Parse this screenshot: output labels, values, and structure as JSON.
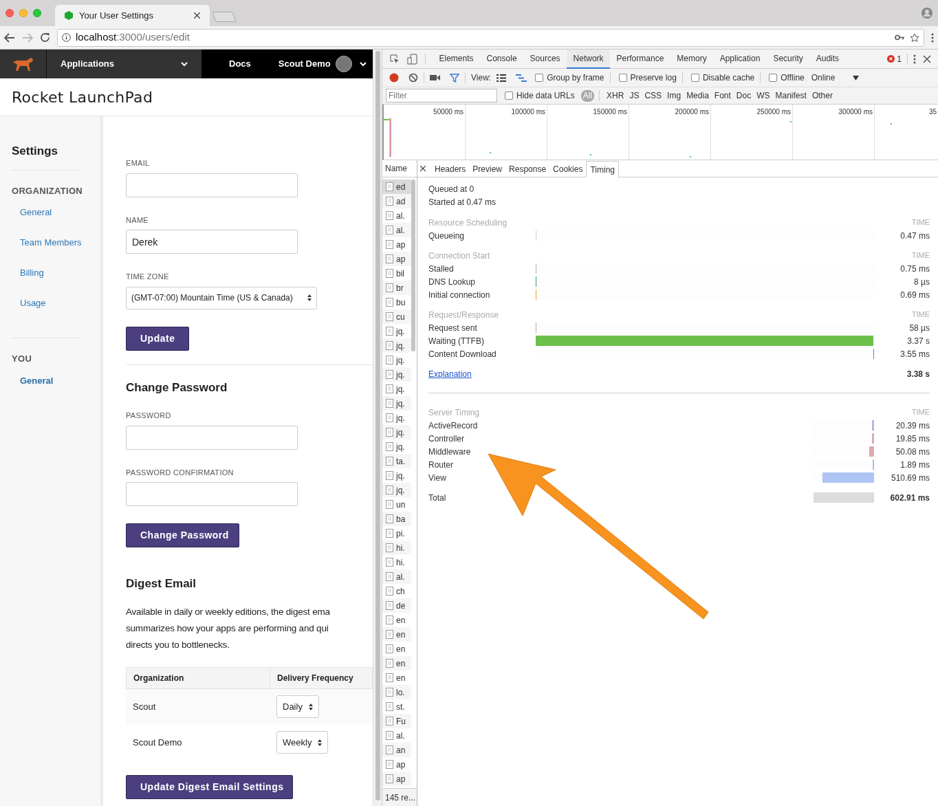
{
  "browser": {
    "tab_title": "Your User Settings",
    "url_host": "localhost",
    "url_path": ":3000/users/edit"
  },
  "navbar": {
    "apps_menu": "Applications",
    "docs": "Docs",
    "account": "Scout Demo"
  },
  "app_title": "Rocket LaunchPad",
  "sidebar": {
    "title": "Settings",
    "groups": [
      {
        "heading": "ORGANIZATION",
        "items": [
          {
            "label": "General",
            "selected": false
          },
          {
            "label": "Team Members",
            "selected": false
          },
          {
            "label": "Billing",
            "selected": false
          },
          {
            "label": "Usage",
            "selected": false
          }
        ]
      },
      {
        "heading": "YOU",
        "items": [
          {
            "label": "General",
            "selected": true
          }
        ]
      }
    ]
  },
  "profile_form": {
    "fields": [
      {
        "kind": "input",
        "label": "EMAIL"
      },
      {
        "kind": "input",
        "label": "NAME",
        "value": "Derek"
      },
      {
        "kind": "select",
        "label": "TIME ZONE",
        "value": "(GMT-07:00) Mountain Time (US & Canada)"
      }
    ],
    "button": "Update"
  },
  "password_form": {
    "title": "Change Password",
    "fields": [
      {
        "kind": "input",
        "label": "PASSWORD"
      },
      {
        "kind": "input",
        "label": "PASSWORD CONFIRMATION"
      }
    ],
    "button": "Change Password"
  },
  "digest": {
    "title": "Digest Email",
    "text": "Available in daily or weekly editions, the digest ema\nsummarizes how your apps are performing and qui\ndirects you to bottlenecks.",
    "columns": [
      "Organization",
      "Delivery Frequency"
    ],
    "rows": [
      {
        "organization": "Scout",
        "frequency": "Daily"
      },
      {
        "organization": "Scout Demo",
        "frequency": "Weekly"
      }
    ],
    "button": "Update Digest Email Settings"
  },
  "devtools": {
    "tabs": [
      {
        "label": "Elements",
        "selected": false
      },
      {
        "label": "Console",
        "selected": false
      },
      {
        "label": "Sources",
        "selected": false
      },
      {
        "label": "Network",
        "selected": true
      },
      {
        "label": "Performance",
        "selected": false
      },
      {
        "label": "Memory",
        "selected": false
      },
      {
        "label": "Application",
        "selected": false
      },
      {
        "label": "Security",
        "selected": false
      },
      {
        "label": "Audits",
        "selected": false
      }
    ],
    "error_count": "1",
    "toolbar": {
      "view_label": "View:",
      "options": [
        {
          "label": "Group by frame",
          "checked": false
        },
        {
          "label": "Preserve log",
          "checked": false
        },
        {
          "label": "Disable cache",
          "checked": false
        },
        {
          "label": "Offline",
          "checked": false
        }
      ],
      "throttle": "Online"
    },
    "filter": {
      "placeholder": "Filter",
      "hide_data_urls": {
        "label": "Hide data URLs",
        "checked": false
      },
      "types": [
        {
          "label": "All",
          "selected": true
        },
        {
          "label": "XHR",
          "selected": false
        },
        {
          "label": "JS",
          "selected": false
        },
        {
          "label": "CSS",
          "selected": false
        },
        {
          "label": "Img",
          "selected": false
        },
        {
          "label": "Media",
          "selected": false
        },
        {
          "label": "Font",
          "selected": false
        },
        {
          "label": "Doc",
          "selected": false
        },
        {
          "label": "WS",
          "selected": false
        },
        {
          "label": "Manifest",
          "selected": false
        },
        {
          "label": "Other",
          "selected": false
        }
      ]
    },
    "overview_ticks": [
      "50000 ms",
      "100000 ms",
      "150000 ms",
      "200000 ms",
      "250000 ms",
      "300000 ms",
      "35"
    ],
    "name_header": "Name",
    "requests": [
      {
        "name": "ed",
        "selected": true
      },
      {
        "name": "ad",
        "selected": false
      },
      {
        "name": "al.",
        "selected": false
      },
      {
        "name": "al.",
        "selected": false
      },
      {
        "name": "ap",
        "selected": false
      },
      {
        "name": "ap",
        "selected": false
      },
      {
        "name": "bil",
        "selected": false
      },
      {
        "name": "br",
        "selected": false
      },
      {
        "name": "bu",
        "selected": false
      },
      {
        "name": "cu",
        "selected": false
      },
      {
        "name": "jq.",
        "selected": false
      },
      {
        "name": "jq.",
        "selected": false
      },
      {
        "name": "jq.",
        "selected": false
      },
      {
        "name": "jq.",
        "selected": false
      },
      {
        "name": "jq.",
        "selected": false
      },
      {
        "name": "jq.",
        "selected": false
      },
      {
        "name": "jq.",
        "selected": false
      },
      {
        "name": "jq.",
        "selected": false
      },
      {
        "name": "jq.",
        "selected": false
      },
      {
        "name": "ta.",
        "selected": false
      },
      {
        "name": "jq.",
        "selected": false
      },
      {
        "name": "jq.",
        "selected": false
      },
      {
        "name": "un",
        "selected": false
      },
      {
        "name": "ba",
        "selected": false
      },
      {
        "name": "pi.",
        "selected": false
      },
      {
        "name": "hi.",
        "selected": false
      },
      {
        "name": "hi.",
        "selected": false
      },
      {
        "name": "al.",
        "selected": false
      },
      {
        "name": "ch",
        "selected": false
      },
      {
        "name": "de",
        "selected": false
      },
      {
        "name": "en",
        "selected": false
      },
      {
        "name": "en",
        "selected": false
      },
      {
        "name": "en",
        "selected": false
      },
      {
        "name": "en",
        "selected": false
      },
      {
        "name": "en",
        "selected": false
      },
      {
        "name": "lo.",
        "selected": false
      },
      {
        "name": "st.",
        "selected": false
      },
      {
        "name": "Fu",
        "selected": false
      },
      {
        "name": "al.",
        "selected": false
      },
      {
        "name": "an",
        "selected": false
      },
      {
        "name": "ap",
        "selected": false
      },
      {
        "name": "ap",
        "selected": false
      }
    ],
    "status": "145 re...",
    "detail_tabs": [
      {
        "label": "Headers",
        "selected": false
      },
      {
        "label": "Preview",
        "selected": false
      },
      {
        "label": "Response",
        "selected": false
      },
      {
        "label": "Cookies",
        "selected": false
      },
      {
        "label": "Timing",
        "selected": true
      }
    ],
    "timing": {
      "queued": "Queued at 0",
      "started": "Started at 0.47 ms",
      "sections": [
        {
          "title": "Resource Scheduling",
          "time_header": "TIME",
          "rows": [
            {
              "label": "Queueing",
              "time": "0.47 ms",
              "level": 0.0001,
              "color": "#d0d0d0"
            }
          ]
        },
        {
          "title": "Connection Start",
          "time_header": "TIME",
          "rows": [
            {
              "label": "Stalled",
              "time": "0.75 ms",
              "level": 0.0002,
              "color": "#b0b0b0"
            },
            {
              "label": "DNS Lookup",
              "time": "8 µs",
              "level": 0.0001,
              "color": "#1f9c7c"
            },
            {
              "label": "Initial connection",
              "time": "0.69 ms",
              "level": 0.0002,
              "color": "#f0a020"
            }
          ]
        },
        {
          "title": "Request/Response",
          "time_header": "TIME",
          "rows": [
            {
              "label": "Request sent",
              "time": "58 µs",
              "level": 0.0001,
              "color": "#b0b0b0"
            },
            {
              "label": "Waiting (TTFB)",
              "time": "3.37 s",
              "level": 0.997,
              "color": "#6cc04a"
            },
            {
              "label": "Content Download",
              "time": "3.55 ms",
              "level": 0.001,
              "color": "#4a8fd9"
            }
          ]
        }
      ],
      "explanation": "Explanation",
      "total": "3.38 s"
    },
    "server_timing": {
      "title": "Server Timing",
      "time_header": "TIME",
      "rows": [
        {
          "label": "ActiveRecord",
          "time": "20.39 ms",
          "level": 0.034,
          "color": "#b4b4e8"
        },
        {
          "label": "Controller",
          "time": "19.85 ms",
          "level": 0.033,
          "color": "#dcaac0"
        },
        {
          "label": "Middleware",
          "time": "50.08 ms",
          "level": 0.083,
          "color": "#e0aaa8"
        },
        {
          "label": "Router",
          "time": "1.89 ms",
          "level": 0.003,
          "color": "#a8b8f0"
        },
        {
          "label": "View",
          "time": "510.69 ms",
          "level": 0.847,
          "color": "#aec4f2"
        }
      ],
      "total_label": "Total",
      "total_time": "602.91 ms"
    }
  }
}
